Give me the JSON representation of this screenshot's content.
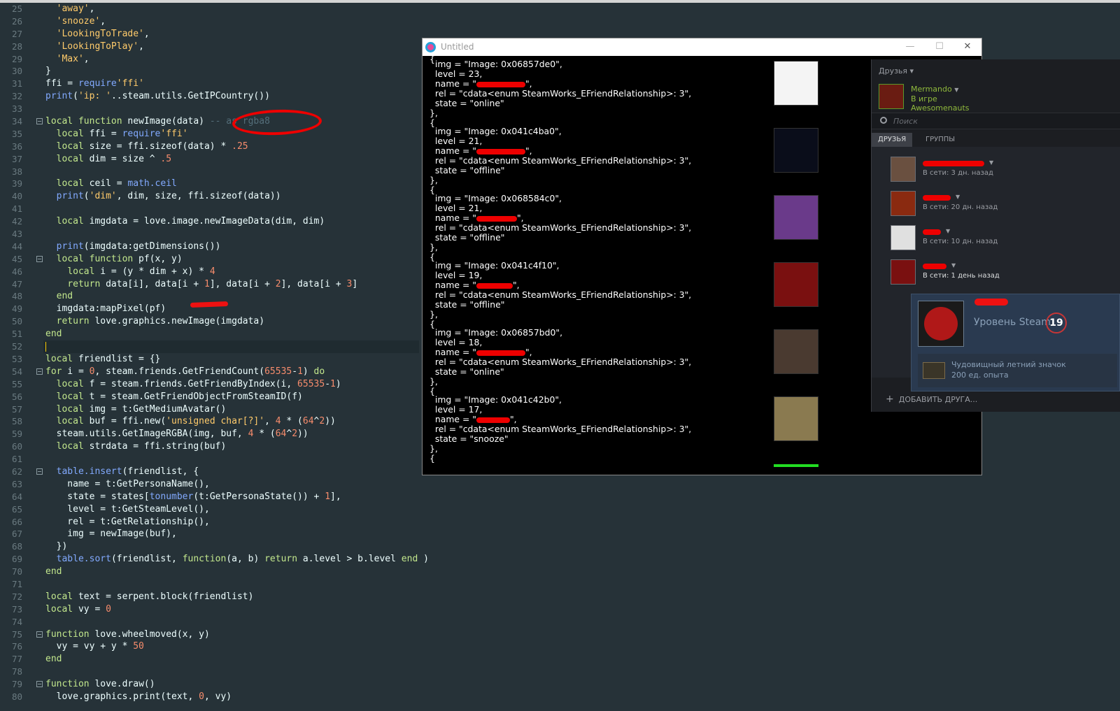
{
  "editor": {
    "lines": [
      {
        "n": "25",
        "html": "  <span class='s'>'away'</span>,"
      },
      {
        "n": "26",
        "html": "  <span class='s'>'snooze'</span>,"
      },
      {
        "n": "27",
        "html": "  <span class='s'>'LookingToTrade'</span>,"
      },
      {
        "n": "28",
        "html": "  <span class='s'>'LookingToPlay'</span>,"
      },
      {
        "n": "29",
        "html": "  <span class='s'>'Max'</span>,"
      },
      {
        "n": "30",
        "html": "}"
      },
      {
        "n": "31",
        "html": "ffi = <span class='f'>require</span><span class='s'>'ffi'</span>"
      },
      {
        "n": "32",
        "html": "<span class='f'>print</span>(<span class='s'>'ip: '</span>..steam.utils.GetIPCountry())"
      },
      {
        "n": "33",
        "html": ""
      },
      {
        "n": "34",
        "html": "<span class='k'>local function</span> newImage(data) <span class='c'>-- as rgba8</span>",
        "fold": true
      },
      {
        "n": "35",
        "html": "  <span class='k'>local</span> ffi = <span class='f'>require</span><span class='s'>'ffi'</span>"
      },
      {
        "n": "36",
        "html": "  <span class='k'>local</span> size = ffi.sizeof(data) * <span class='n'>.25</span>"
      },
      {
        "n": "37",
        "html": "  <span class='k'>local</span> dim = size ^ <span class='n'>.5</span>"
      },
      {
        "n": "38",
        "html": ""
      },
      {
        "n": "39",
        "html": "  <span class='k'>local</span> ceil = <span class='f'>math.ceil</span>"
      },
      {
        "n": "40",
        "html": "  <span class='f'>print</span>(<span class='s'>'dim'</span>, dim, size, ffi.sizeof(data))"
      },
      {
        "n": "41",
        "html": ""
      },
      {
        "n": "42",
        "html": "  <span class='k'>local</span> imgdata = love.image.newImageData(dim, dim)"
      },
      {
        "n": "43",
        "html": ""
      },
      {
        "n": "44",
        "html": "  <span class='f'>print</span>(imgdata:getDimensions())"
      },
      {
        "n": "45",
        "html": "  <span class='k'>local function</span> pf(x, y)",
        "fold": true
      },
      {
        "n": "46",
        "html": "    <span class='k'>local</span> i = (y * dim + x) * <span class='n'>4</span>"
      },
      {
        "n": "47",
        "html": "    <span class='k'>return</span> data[i], data[i + <span class='n'>1</span>], data[i + <span class='n'>2</span>], data[i + <span class='n'>3</span>]"
      },
      {
        "n": "48",
        "html": "  <span class='k'>end</span>"
      },
      {
        "n": "49",
        "html": "  imgdata:mapPixel(pf)"
      },
      {
        "n": "50",
        "html": "  <span class='k'>return</span> love.graphics.newImage(imgdata)"
      },
      {
        "n": "51",
        "html": "<span class='k'>end</span>"
      },
      {
        "n": "52",
        "html": "",
        "active": true
      },
      {
        "n": "53",
        "html": "<span class='k'>local</span> friendlist = {}"
      },
      {
        "n": "54",
        "html": "<span class='k'>for</span> i = <span class='n'>0</span>, steam.friends.GetFriendCount(<span class='n'>65535</span>-<span class='n'>1</span>) <span class='k'>do</span>",
        "fold": true
      },
      {
        "n": "55",
        "html": "  <span class='k'>local</span> f = steam.friends.GetFriendByIndex(i, <span class='n'>65535</span>-<span class='n'>1</span>)"
      },
      {
        "n": "56",
        "html": "  <span class='k'>local</span> t = steam.GetFriendObjectFromSteamID(f)"
      },
      {
        "n": "57",
        "html": "  <span class='k'>local</span> img = t:GetMediumAvatar()"
      },
      {
        "n": "58",
        "html": "  <span class='k'>local</span> buf = ffi.new(<span class='s'>'unsigned char[?]'</span>, <span class='n'>4</span> * (<span class='n'>64</span>^<span class='n'>2</span>))"
      },
      {
        "n": "59",
        "html": "  steam.utils.GetImageRGBA(img, buf, <span class='n'>4</span> * (<span class='n'>64</span>^<span class='n'>2</span>))"
      },
      {
        "n": "60",
        "html": "  <span class='k'>local</span> strdata = ffi.string(buf)"
      },
      {
        "n": "61",
        "html": ""
      },
      {
        "n": "62",
        "html": "  <span class='f'>table.insert</span>(friendlist, {",
        "fold": true
      },
      {
        "n": "63",
        "html": "    name = t:GetPersonaName(),"
      },
      {
        "n": "64",
        "html": "    state = states[<span class='f'>tonumber</span>(t:GetPersonaState()) + <span class='n'>1</span>],"
      },
      {
        "n": "65",
        "html": "    level = t:GetSteamLevel(),"
      },
      {
        "n": "66",
        "html": "    rel = t:GetRelationship(),"
      },
      {
        "n": "67",
        "html": "    img = newImage(buf),"
      },
      {
        "n": "68",
        "html": "  })"
      },
      {
        "n": "69",
        "html": "  <span class='f'>table.sort</span>(friendlist, <span class='k'>function</span>(a, b) <span class='k'>return</span> a.level &gt; b.level <span class='k'>end</span> )"
      },
      {
        "n": "70",
        "html": "<span class='k'>end</span>"
      },
      {
        "n": "71",
        "html": ""
      },
      {
        "n": "72",
        "html": "<span class='k'>local</span> text = serpent.block(friendlist)"
      },
      {
        "n": "73",
        "html": "<span class='k'>local</span> vy = <span class='n'>0</span>"
      },
      {
        "n": "74",
        "html": ""
      },
      {
        "n": "75",
        "html": "<span class='k'>function</span> love.wheelmoved(x, y)",
        "fold": true
      },
      {
        "n": "76",
        "html": "  vy = vy + y * <span class='n'>50</span>"
      },
      {
        "n": "77",
        "html": "<span class='k'>end</span>"
      },
      {
        "n": "78",
        "html": ""
      },
      {
        "n": "79",
        "html": "<span class='k'>function</span> love.draw()",
        "fold": true
      },
      {
        "n": "80",
        "html": "  love.graphics.print(text, <span class='n'>0</span>, vy)"
      }
    ]
  },
  "love_window": {
    "title": "Untitled",
    "minimize": "—",
    "maximize": "☐",
    "close": "✕",
    "entries": [
      {
        "img": "\"Image: 0x06857de0\",",
        "level": "23,",
        "name_prefix": "name = \"",
        "name_suffix": "\",",
        "rel": "rel = \"cdata<enum SteamWorks_EFriendRelationship>: 3\",",
        "state": "state = \"online\"",
        "av_color": "#f4f4f4"
      },
      {
        "img": "\"Image: 0x041c4ba0\",",
        "level": "21,",
        "name_prefix": "name = \"",
        "name_suffix": "\",",
        "rel": "rel = \"cdata<enum SteamWorks_EFriendRelationship>: 3\",",
        "state": "state = \"offline\"",
        "av_color": "#0a0d1a"
      },
      {
        "img": "\"Image: 0x068584c0\",",
        "level": "21,",
        "name_prefix": "name = \"",
        "name_suffix": "\",",
        "rel": "rel = \"cdata<enum SteamWorks_EFriendRelationship>: 3\",",
        "state": "state = \"offline\"",
        "av_color": "#6a3a8a"
      },
      {
        "img": "\"Image: 0x041c4f10\",",
        "level": "19,",
        "name_prefix": "name = \"",
        "name_suffix": "\",",
        "rel": "rel = \"cdata<enum SteamWorks_EFriendRelationship>: 3\",",
        "state": "state = \"offline\"",
        "av_color": "#7a1010"
      },
      {
        "img": "\"Image: 0x06857bd0\",",
        "level": "18,",
        "name_prefix": "name = \"",
        "name_suffix": "\",",
        "rel": "rel = \"cdata<enum SteamWorks_EFriendRelationship>: 3\",",
        "state": "state = \"online\"",
        "av_color": "#4a3a30"
      },
      {
        "img": "\"Image: 0x041c42b0\",",
        "level": "17,",
        "name_prefix": "name = \"",
        "name_suffix": "\",",
        "rel": "rel = \"cdata<enum SteamWorks_EFriendRelationship>: 3\",",
        "state": "state = \"snooze\"",
        "av_color": "#8a7a50"
      }
    ],
    "open_brace": "{",
    "close_brace": "},",
    "img_key": "img = ",
    "level_key": "level = "
  },
  "steam": {
    "header": "Друзья",
    "user_name": "Mermando",
    "user_status": "В игре",
    "user_game": "Awesomenauts",
    "search_placeholder": "Поиск",
    "tab_friends": "ДРУЗЬЯ",
    "tab_groups": "ГРУППЫ",
    "friends": [
      {
        "status": "В сети: 3 дн. назад",
        "color": "#6a5040"
      },
      {
        "status": "В сети: 20 дн. назад",
        "color": "#8a2a10"
      },
      {
        "status": "В сети: 10 дн. назад",
        "color": "#e0e0e0"
      },
      {
        "status": "В сети: 1 день назад",
        "color": "#7a1010"
      }
    ],
    "add_friend": "ДОБАВИТЬ ДРУГА...",
    "add_icon": "+",
    "popup": {
      "level_label": "Уровень Steam",
      "level": "19",
      "badge_name": "Чудовищный летний значок",
      "badge_xp": "200 ед. опыта"
    }
  }
}
